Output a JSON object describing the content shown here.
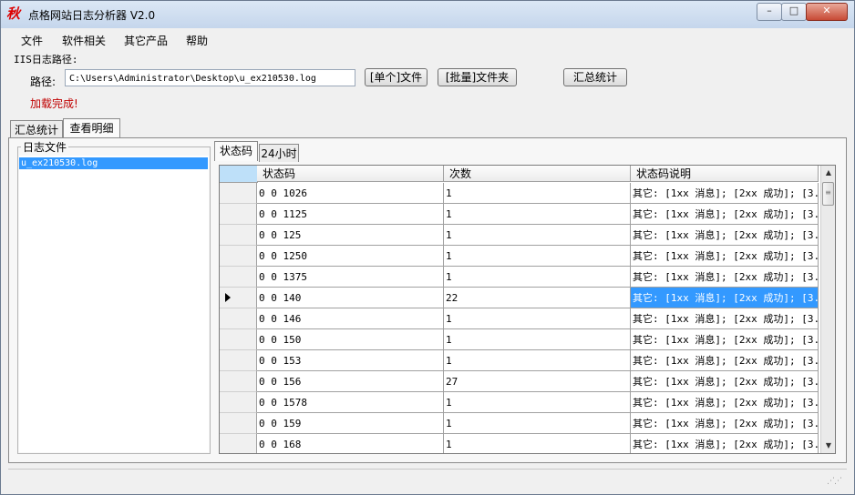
{
  "window": {
    "title": "点格网站日志分析器 V2.0",
    "app_icon_glyph": "秋",
    "minimize_icon": "minimize-icon",
    "maximize_icon": "maximize-icon",
    "close_icon": "close-icon"
  },
  "menu": [
    "文件",
    "软件相关",
    "其它产品",
    "帮助"
  ],
  "path_group": {
    "label": "IIS日志路径:",
    "path_label": "路径:",
    "path_value": "C:\\Users\\Administrator\\Desktop\\u_ex210530.log",
    "single_file_button": "[单个]文件",
    "batch_folder_button": "[批量]文件夹",
    "summary_button": "汇总统计",
    "status_message": "加载完成!"
  },
  "main_tabs": [
    "汇总统计",
    "查看明细"
  ],
  "active_main_tab": "查看明细",
  "log_files": {
    "title": "日志文件",
    "items": [
      "u_ex210530.log"
    ],
    "selected": "u_ex210530.log"
  },
  "detail_tabs": [
    "状态码",
    "24小时"
  ],
  "active_detail_tab": "状态码",
  "grid": {
    "columns": [
      "状态码",
      "次数",
      "状态码说明"
    ],
    "rows": [
      {
        "code": "0 0 1026",
        "count": "1",
        "desc": "其它: [1xx 消息]; [2xx 成功]; [3..."
      },
      {
        "code": "0 0 1125",
        "count": "1",
        "desc": "其它: [1xx 消息]; [2xx 成功]; [3..."
      },
      {
        "code": "0 0 125",
        "count": "1",
        "desc": "其它: [1xx 消息]; [2xx 成功]; [3..."
      },
      {
        "code": "0 0 1250",
        "count": "1",
        "desc": "其它: [1xx 消息]; [2xx 成功]; [3..."
      },
      {
        "code": "0 0 1375",
        "count": "1",
        "desc": "其它: [1xx 消息]; [2xx 成功]; [3..."
      },
      {
        "code": "0 0 140",
        "count": "22",
        "desc": "其它: [1xx 消息]; [2xx 成功]; [3..."
      },
      {
        "code": "0 0 146",
        "count": "1",
        "desc": "其它: [1xx 消息]; [2xx 成功]; [3..."
      },
      {
        "code": "0 0 150",
        "count": "1",
        "desc": "其它: [1xx 消息]; [2xx 成功]; [3..."
      },
      {
        "code": "0 0 153",
        "count": "1",
        "desc": "其它: [1xx 消息]; [2xx 成功]; [3..."
      },
      {
        "code": "0 0 156",
        "count": "27",
        "desc": "其它: [1xx 消息]; [2xx 成功]; [3..."
      },
      {
        "code": "0 0 1578",
        "count": "1",
        "desc": "其它: [1xx 消息]; [2xx 成功]; [3..."
      },
      {
        "code": "0 0 159",
        "count": "1",
        "desc": "其它: [1xx 消息]; [2xx 成功]; [3..."
      },
      {
        "code": "0 0 168",
        "count": "1",
        "desc": "其它: [1xx 消息]; [2xx 成功]; [3..."
      }
    ],
    "selected_row": 5,
    "selection_color": "#3399ff"
  }
}
